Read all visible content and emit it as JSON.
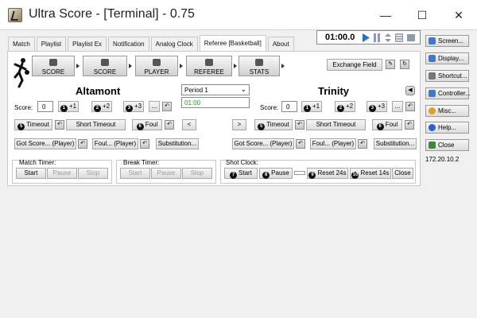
{
  "window": {
    "title": "Ultra Score - [Terminal] - 0.75",
    "minimize": "—",
    "maximize": "☐",
    "close": "✕"
  },
  "tabs": [
    "Match",
    "Playlist",
    "Playlist Ex",
    "Notification",
    "Analog Clock",
    "Referee [Basketball]",
    "About"
  ],
  "timer": {
    "value": "01:00.0"
  },
  "big_buttons": [
    "SCORE",
    "SCORE",
    "PLAYER",
    "REFEREE",
    "STATS"
  ],
  "exchange_field": "Exchange Field",
  "home": {
    "name": "Altamont",
    "score_label": "Score:",
    "score": "0",
    "plus1": "+1",
    "plus2": "+2",
    "plus3": "+3",
    "more": "...",
    "timeout": "Timeout",
    "short_timeout": "Short Timeout",
    "foul": "Foul",
    "got_score": "Got Score... (Player)",
    "foul_player": "Foul... (Player)",
    "substitution": "Substitution..."
  },
  "away": {
    "name": "Trinity",
    "score_label": "Score:",
    "score": "0",
    "plus1": "+1",
    "plus2": "+2",
    "plus3": "+3",
    "more": "...",
    "timeout": "Timeout",
    "short_timeout": "Short Timeout",
    "foul": "Foul",
    "got_score": "Got Score... (Player)",
    "foul_player": "Foul... (Player)",
    "substitution": "Substitution..."
  },
  "period": {
    "selected": "Period 1",
    "clock": "01:00"
  },
  "nav": {
    "prev": "<",
    "next": ">"
  },
  "match_timer": {
    "label": "Match Timer:",
    "start": "Start",
    "pause": "Pause",
    "stop": "Stop"
  },
  "break_timer": {
    "label": "Break Timer:",
    "start": "Start",
    "pause": "Pause",
    "stop": "Stop"
  },
  "shot_clock": {
    "label": "Shot Clock:",
    "start": "Start",
    "pause": "Pause",
    "reset24": "Reset 24s",
    "reset14": "Reset 14s",
    "close": "Close"
  },
  "sidebar": [
    "Screen...",
    "Display...",
    "Shortcut...",
    "Controller...",
    "Misc...",
    "Help...",
    "Close"
  ],
  "ip_address": "172.20.10.2",
  "icons": {
    "play": "play-icon",
    "pause": "pause-icon",
    "adjust": "adjust-icon",
    "grid": "grid-icon",
    "stop": "stop-icon",
    "edit": "edit-icon",
    "refresh": "refresh-icon",
    "mute": "speaker-icon"
  },
  "colors": {
    "clock_green": "#1a9a1a",
    "play_blue": "#2a6fd0"
  }
}
